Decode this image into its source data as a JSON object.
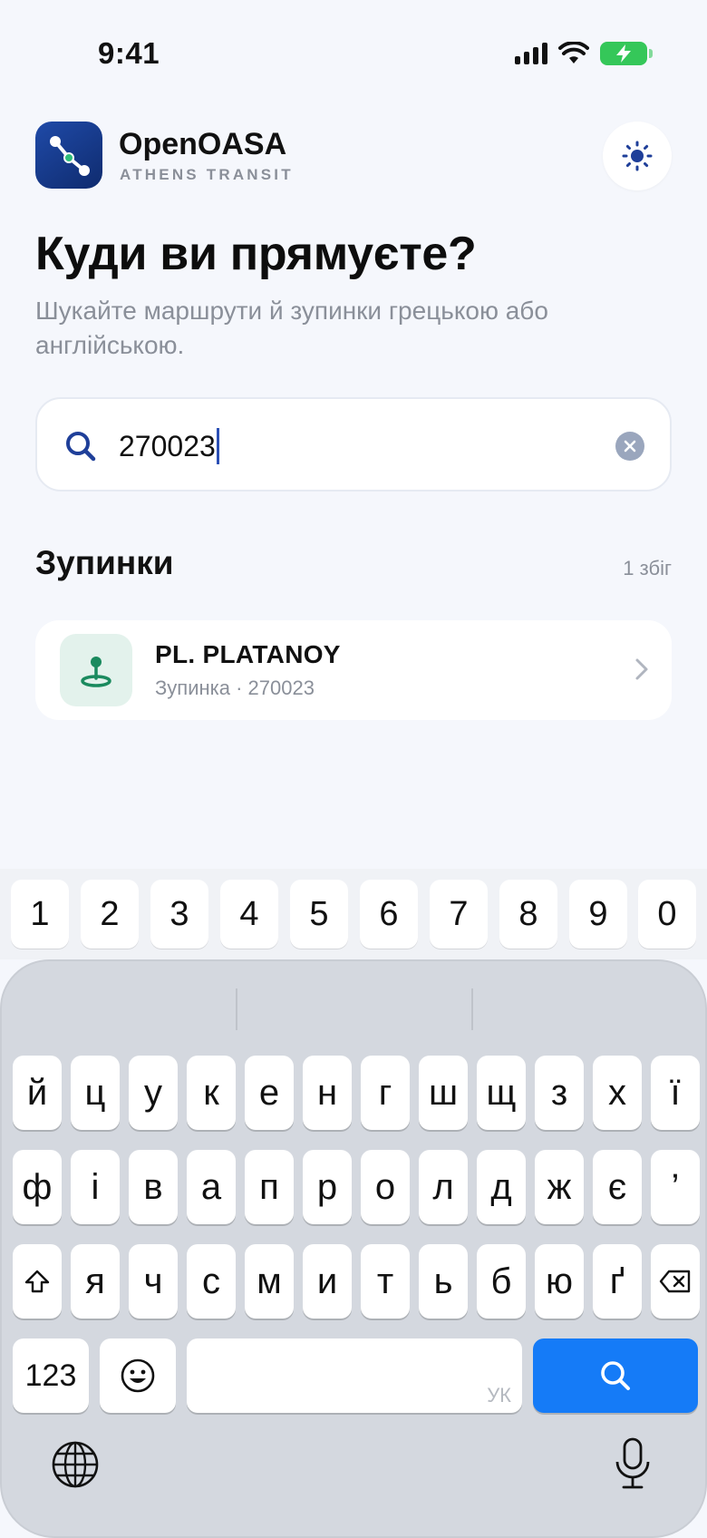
{
  "status": {
    "time": "9:41"
  },
  "header": {
    "app_name": "OpenOASA",
    "app_subtitle": "ATHENS TRANSIT",
    "logo_icon": "route-icon",
    "theme_icon": "sun-icon"
  },
  "page": {
    "title": "Куди ви прямуєте?",
    "subtitle": "Шукайте маршрути й зупинки грецькою або англійською."
  },
  "search": {
    "value": "270023",
    "icon": "search-icon",
    "clear_icon": "clear-icon"
  },
  "results": {
    "section_title": "Зупинки",
    "count": "1 збіг",
    "items": [
      {
        "name": "PL. PLATANOY",
        "meta": "Зупинка · 270023",
        "icon": "stop-pin-icon"
      }
    ]
  },
  "keyboard": {
    "numbers": [
      "1",
      "2",
      "3",
      "4",
      "5",
      "6",
      "7",
      "8",
      "9",
      "0"
    ],
    "row1": [
      "й",
      "ц",
      "у",
      "к",
      "е",
      "н",
      "г",
      "ш",
      "щ",
      "з",
      "х",
      "ї"
    ],
    "row2": [
      "ф",
      "і",
      "в",
      "а",
      "п",
      "р",
      "о",
      "л",
      "д",
      "ж",
      "є",
      "’"
    ],
    "row3": [
      "я",
      "ч",
      "с",
      "м",
      "и",
      "т",
      "ь",
      "б",
      "ю",
      "ґ"
    ],
    "mode_key": "123",
    "space_lang": "УК",
    "accent_color": "#157bf7"
  }
}
